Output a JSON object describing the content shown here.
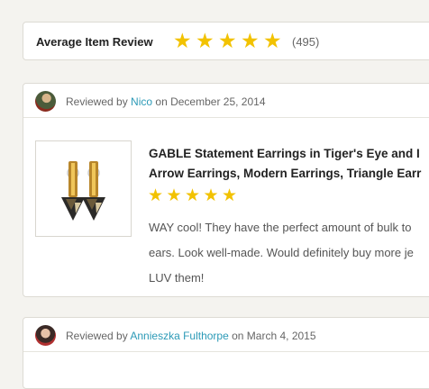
{
  "summary": {
    "title": "Average Item Review",
    "rating": 5,
    "count": "(495)"
  },
  "reviews": [
    {
      "prefix": "Reviewed by",
      "user": "Nico",
      "on": "on December 25, 2014",
      "product_title_lines": [
        "GABLE Statement Earrings in Tiger's Eye and I",
        "Arrow Earrings, Modern Earrings, Triangle Earr"
      ],
      "rating": 5,
      "text_lines": [
        "WAY cool! They have the perfect amount of bulk to",
        "ears. Look well-made. Would definitely buy more je",
        "LUV them!"
      ]
    },
    {
      "prefix": "Reviewed by",
      "user": "Annieszka Fulthorpe",
      "on": "on March 4, 2015"
    }
  ],
  "icons": {
    "star": "star-icon",
    "avatar": "user-avatar"
  },
  "colors": {
    "star": "#f2c200",
    "link": "#2c9ab7",
    "background": "#f4f3ef"
  }
}
